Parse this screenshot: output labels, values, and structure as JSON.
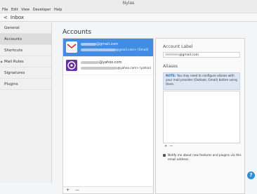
{
  "window": {
    "title": "Nylas"
  },
  "menu": [
    "File",
    "Edit",
    "View",
    "Developer",
    "Help"
  ],
  "toolbar": {
    "back_label": "Inbox"
  },
  "sidebar": {
    "items": [
      {
        "label": "General"
      },
      {
        "label": "Accounts"
      },
      {
        "label": "Shortcuts"
      },
      {
        "label": "Mail Rules"
      },
      {
        "label": "Signatures"
      },
      {
        "label": "Plugins"
      }
    ]
  },
  "accounts": {
    "heading": "Accounts",
    "list": [
      {
        "email": "@gmail.com",
        "detail": "@gmail.com> (Gmail)"
      },
      {
        "email": "@yahoo.com",
        "detail": "@yahoo.com> (yahoo)"
      }
    ],
    "add_label": "+",
    "remove_label": "—"
  },
  "detail": {
    "account_label_heading": "Account Label",
    "account_label_value": "@gmail.com",
    "aliases_heading": "Aliases",
    "note_prefix": "NOTE:",
    "note_text": "You may need to configure aliases with your mail provider (Outlook, Gmail) before using them.",
    "aliases_add": "+",
    "aliases_remove": "—",
    "notify_text": "Notify me about new features and plugins via this email address."
  },
  "help": {
    "label": "?"
  }
}
